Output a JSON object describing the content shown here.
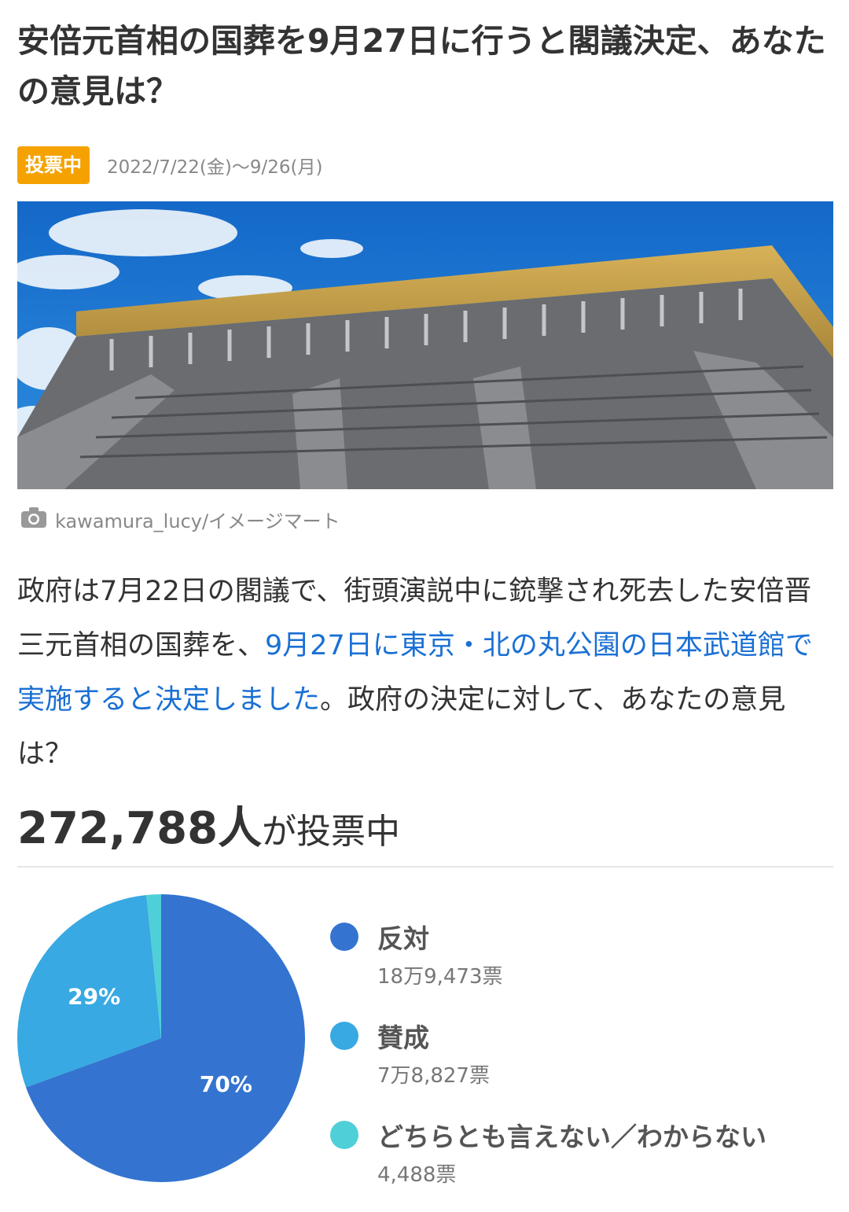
{
  "poll": {
    "title": "安倍元首相の国葬を9月27日に行うと閣議決定、あなたの意見は？",
    "status_badge": "投票中",
    "period": "2022/7/22(金)〜9/26(月)",
    "photo_credit": "kawamura_lucy/イメージマート",
    "description_before_link": "政府は7月22日の閣議で、街頭演説中に銃撃され死去した安倍晋三元首相の国葬を、",
    "description_link": "9月27日に東京・北の丸公園の日本武道館で実施すると決定しました",
    "description_after_link": "。政府の決定に対して、あなたの意見は？",
    "voters_count": "272,788人",
    "voters_suffix": "が投票中"
  },
  "icons": {
    "camera": "camera-icon"
  },
  "colors": {
    "badge": "#f5a200",
    "link": "#1a70d4",
    "oppose": "#3474d0",
    "support": "#38a9e2",
    "undecided": "#4fcfd8"
  },
  "chart_data": {
    "type": "pie",
    "slices": [
      {
        "label": "反対",
        "votes_text": "18万9,473票",
        "value": 189473,
        "percent_label": "70%",
        "color": "#3474d0"
      },
      {
        "label": "賛成",
        "votes_text": "7万8,827票",
        "value": 78827,
        "percent_label": "29%",
        "color": "#38a9e2"
      },
      {
        "label": "どちらとも言えない／わからない",
        "votes_text": "4,488票",
        "value": 4488,
        "percent_label": "",
        "color": "#4fcfd8"
      }
    ]
  }
}
